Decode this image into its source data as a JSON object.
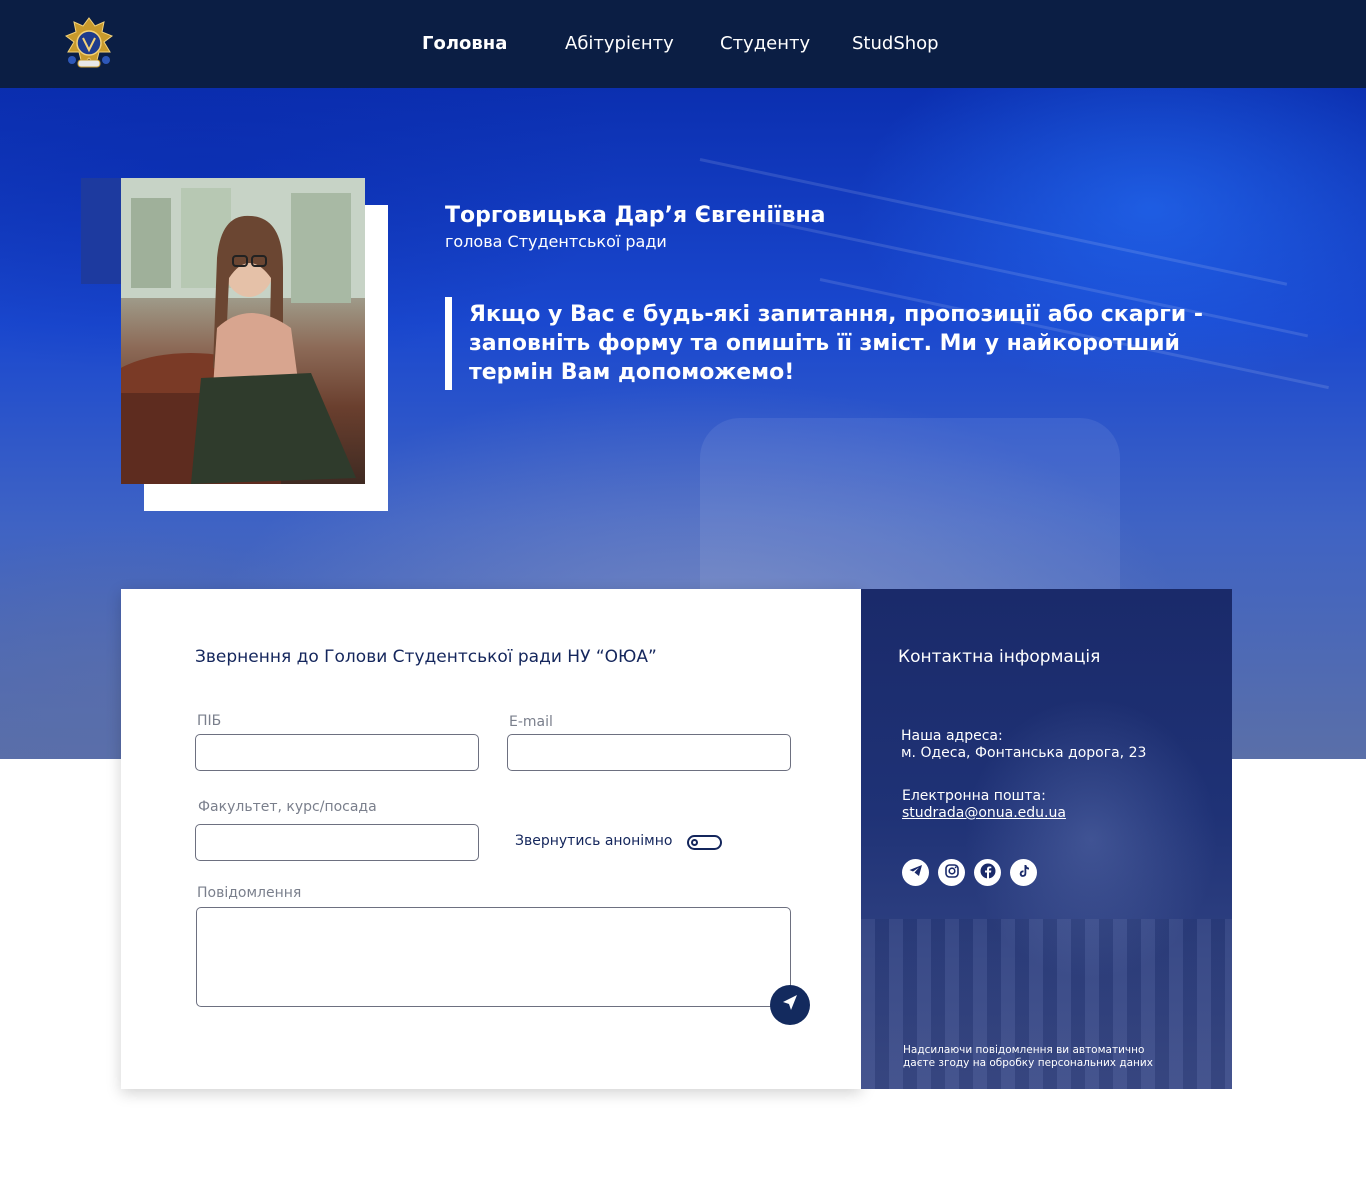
{
  "nav": {
    "items": [
      {
        "label": "Головна",
        "active": true
      },
      {
        "label": "Абітурієнту",
        "active": false
      },
      {
        "label": "Студенту",
        "active": false
      },
      {
        "label": "StudShop",
        "active": false
      }
    ]
  },
  "hero": {
    "name": "Торговицька Дар’я Євгеніївна",
    "role": "голова Студентської ради",
    "quote": "Якщо у Вас є будь-які запитання, пропозиції або скарги - заповніть форму та опишіть її зміст. Ми у найкоротший термін Вам допоможемо!"
  },
  "form": {
    "title": "Звернення до Голови Студентської ради НУ “ОЮА”",
    "name_label": "ПІБ",
    "name_value": "",
    "email_label": "E-mail",
    "email_value": "",
    "faculty_label": "Факультет, курс/посада",
    "faculty_value": "",
    "anonymous_label": "Звернутись анонімно",
    "anonymous_on": false,
    "message_label": "Повідомлення",
    "message_value": ""
  },
  "contact": {
    "title": "Контактна інформація",
    "address_label": "Наша адреса:",
    "address_value": "м. Одеса, Фонтанська дорога, 23",
    "email_label": "Електронна пошта:",
    "email_value": "studrada@onua.edu.ua",
    "socials": [
      "telegram-icon",
      "instagram-icon",
      "facebook-icon",
      "tiktok-icon"
    ],
    "consent_line1": "Надсилаючи повідомлення ви автоматично",
    "consent_line2": "даєте згоду на обробку персональних даних"
  },
  "colors": {
    "header_bg": "#0b1e44",
    "accent": "#132a5e",
    "contact_bg": "#1f3276"
  }
}
